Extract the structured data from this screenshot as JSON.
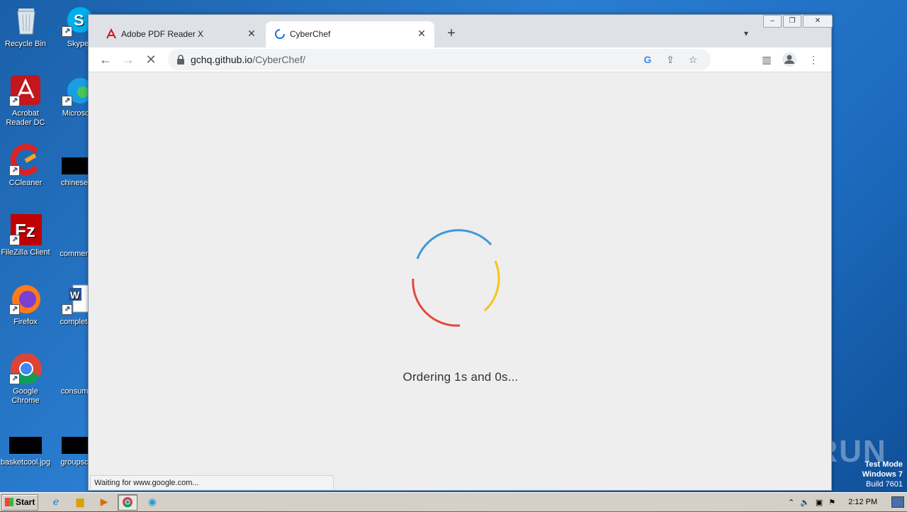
{
  "desktop": {
    "icons": [
      {
        "label": "Recycle Bin",
        "icon": "recycle-bin-icon"
      },
      {
        "label": "Skype",
        "icon": "skype-icon"
      },
      {
        "label": "Acrobat Reader DC",
        "icon": "acrobat-icon"
      },
      {
        "label": "Microsoft",
        "icon": "edge-icon"
      },
      {
        "label": "CCleaner",
        "icon": "ccleaner-icon"
      },
      {
        "label": "chineseur",
        "icon": "file-icon"
      },
      {
        "label": "FileZilla Client",
        "icon": "filezilla-icon"
      },
      {
        "label": "commerce",
        "icon": "file-icon"
      },
      {
        "label": "Firefox",
        "icon": "firefox-icon"
      },
      {
        "label": "completen",
        "icon": "word-icon"
      },
      {
        "label": "Google Chrome",
        "icon": "chrome-icon"
      },
      {
        "label": "consumer",
        "icon": "file-icon"
      },
      {
        "label": "basketcool.jpg",
        "icon": "image-icon"
      },
      {
        "label": "groupscor",
        "icon": "file-icon"
      }
    ]
  },
  "browser": {
    "tabs": [
      {
        "label": "Adobe PDF Reader X",
        "icon": "adobe-icon",
        "active": false
      },
      {
        "label": "CyberChef",
        "icon": "loading-spinner-icon",
        "active": true
      }
    ],
    "url": {
      "host": "gchq.github.io",
      "path": "/CyberChef/"
    },
    "loading_text": "Ordering 1s and 0s...",
    "status_text": "Waiting for www.google.com..."
  },
  "watermark": "ANY RUN",
  "system": {
    "test_mode_line1": "Test Mode",
    "test_mode_line2": "Windows 7",
    "test_mode_line3": "Build 7601",
    "start_label": "Start",
    "clock": "2:12 PM"
  },
  "colors": {
    "spinner_blue": "#3f9ad7",
    "spinner_yellow": "#f5c518",
    "spinner_red": "#e8463b"
  }
}
